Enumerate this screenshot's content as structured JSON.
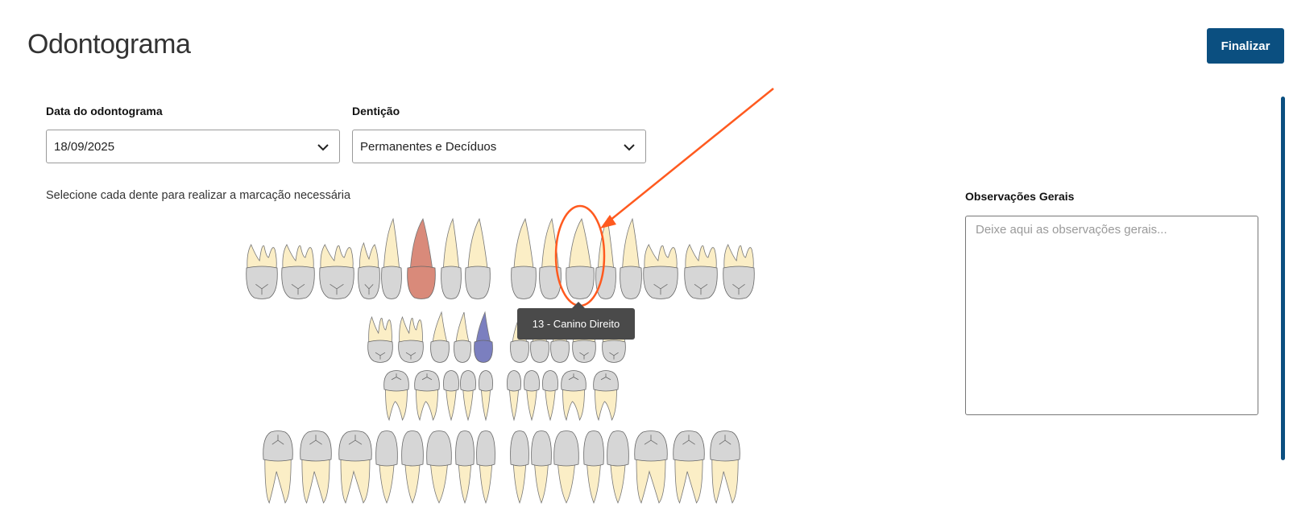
{
  "header": {
    "title": "Odontograma",
    "finalize_label": "Finalizar"
  },
  "form": {
    "date_label": "Data do odontograma",
    "date_value": "18/09/2025",
    "dentition_label": "Dentição",
    "dentition_value": "Permanentes e Decíduos"
  },
  "instructions": "Selecione cada dente para realizar a marcação necessária",
  "observations": {
    "label": "Observações Gerais",
    "placeholder": "Deixe aqui as observações gerais..."
  },
  "tooltip": "13 - Canino Direito",
  "colors": {
    "primary": "#0b4f80",
    "root": "#fbeec6",
    "crown": "#d6d6d6",
    "marked_red": "#d98a7a",
    "marked_blue": "#7b7fbf",
    "annotation_orange": "#ff5a1f"
  },
  "icons": [
    "chevron-down-icon",
    "chevron-down-icon",
    "tooth-icon"
  ]
}
